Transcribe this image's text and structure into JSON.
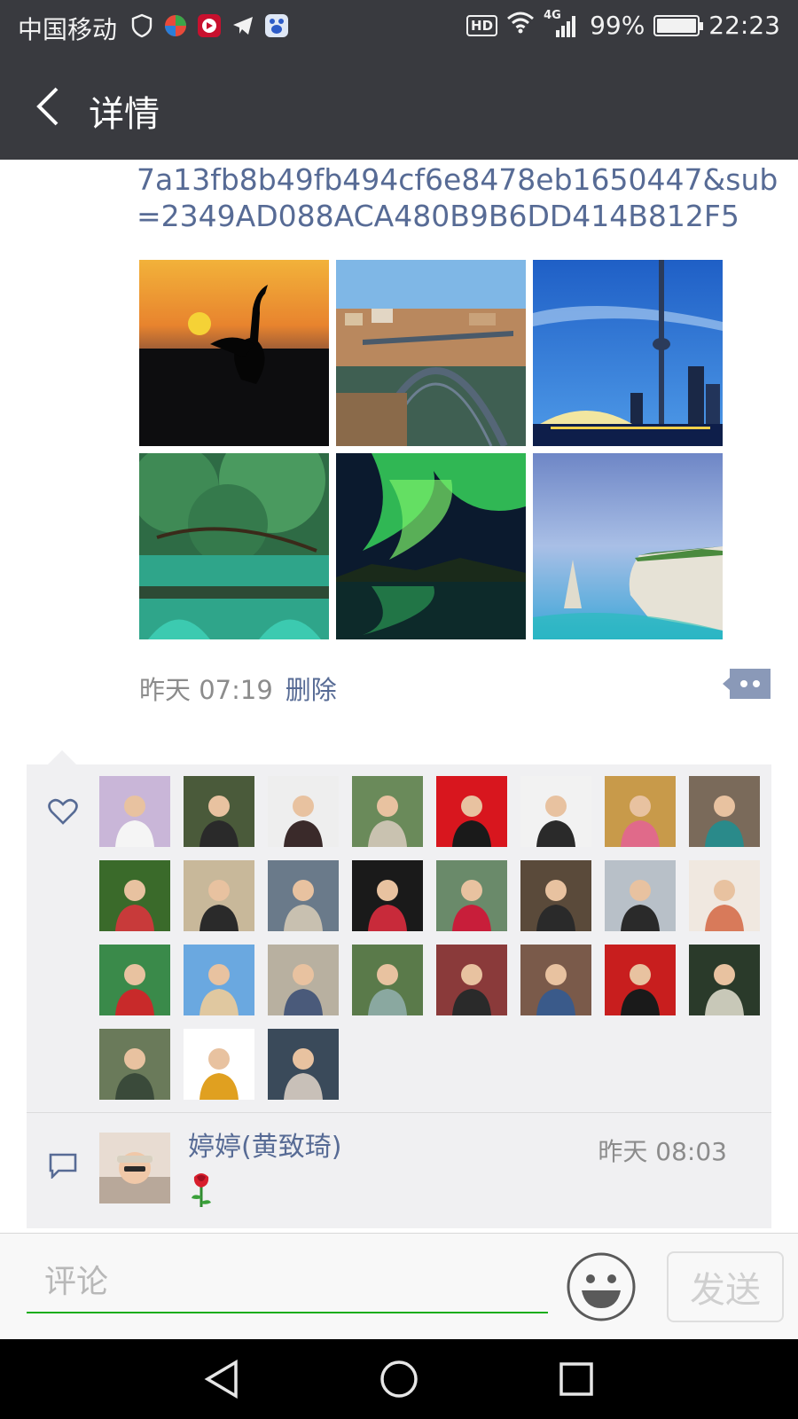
{
  "status_bar": {
    "carrier": "中国移动",
    "hd": "HD",
    "network": "4G",
    "battery": "99%",
    "time": "22:23"
  },
  "header": {
    "title": "详情",
    "back_icon": "back-arrow-icon"
  },
  "post": {
    "link_text": "7a13fb8b49fb494cf6e8478eb1650447&sub=2349AD088ACA480B9B6DD414B812F5",
    "photos": [
      {
        "subject": "crane silhouette at sunset"
      },
      {
        "subject": "arched iron bridge over river town"
      },
      {
        "subject": "CN tower city skyline"
      },
      {
        "subject": "green river with stone bridge"
      },
      {
        "subject": "green aurora over lake"
      },
      {
        "subject": "white cliffs over blue sea"
      }
    ],
    "time": "昨天 07:19",
    "delete_label": "删除",
    "more_icon": "more-dots-icon"
  },
  "likes": {
    "icon": "heart-icon",
    "count": 27
  },
  "comments": [
    {
      "name": "婷婷(黄致琦)",
      "time": "昨天 08:03",
      "content_icon": "rose-icon"
    }
  ],
  "input": {
    "placeholder": "评论",
    "value": "",
    "emoji_icon": "smiley-icon",
    "send_label": "发送"
  },
  "colors": {
    "header_bg": "#393a3f",
    "link": "#576b95",
    "meta_gray": "#8c8c8c",
    "panel_bg": "#f0f0f2",
    "input_underline": "#1aad19"
  }
}
